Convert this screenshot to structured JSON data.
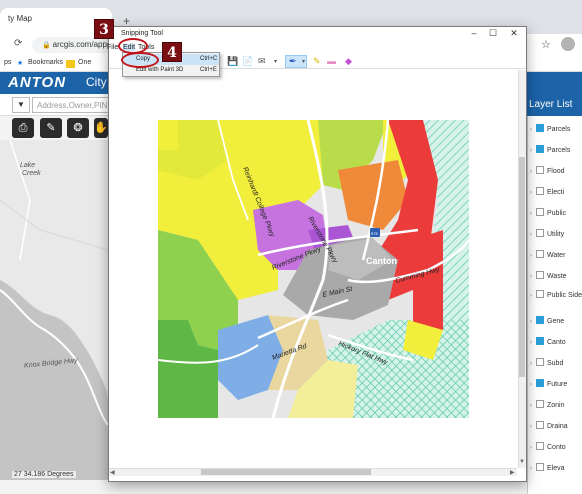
{
  "browser": {
    "tab_title": "ty Map",
    "new_tab": "+",
    "address": "arcgis.com/apps/",
    "bookmarks": [
      "ps",
      "Bookmarks",
      "One"
    ],
    "bookmarks_star": "★"
  },
  "app": {
    "logo": "ANTON",
    "logo_city": "City",
    "search_placeholder": "Address,Owner,PIN,",
    "scale": "27 34.186 Degrees",
    "bg_map_labels": [
      "Lake",
      "Creek",
      "Knox Bridge Hwy"
    ]
  },
  "layer_panel": {
    "title": "Layer List",
    "items": [
      {
        "label": "Parcels",
        "checked": true
      },
      {
        "label": "Parcels",
        "checked": true
      },
      {
        "label": "Flood",
        "checked": false
      },
      {
        "label": "Electi",
        "checked": false
      },
      {
        "label": "Public",
        "checked": false
      },
      {
        "label": "Utility",
        "checked": false
      },
      {
        "label": "Water",
        "checked": false
      },
      {
        "label": "Waste",
        "checked": false
      },
      {
        "label": "Public Sidew",
        "checked": false
      },
      {
        "label": "Gene",
        "checked": true
      },
      {
        "label": "Canto",
        "checked": true
      },
      {
        "label": "Subd",
        "checked": false
      },
      {
        "label": "Future",
        "checked": true
      },
      {
        "label": "Zonin",
        "checked": false
      },
      {
        "label": "Draina",
        "checked": false
      },
      {
        "label": "Conto",
        "checked": false
      },
      {
        "label": "Eleva",
        "checked": false
      }
    ]
  },
  "snipping_tool": {
    "title": "Snipping Tool",
    "menu": [
      "File",
      "Edit",
      "Tools"
    ],
    "edit_menu": [
      {
        "label": "Copy",
        "shortcut": "Ctrl+C"
      },
      {
        "label": "Edit with Paint 3D",
        "shortcut": "Ctrl+E"
      }
    ],
    "window_controls": {
      "minimize": "–",
      "maximize": "☐",
      "close": "✕"
    }
  },
  "annotations": {
    "step3": "3",
    "step4": "4"
  },
  "map": {
    "labels": {
      "college": "Reinhardt College Pkwy",
      "riverstone": "Riverstone Pkwy",
      "canton": "Canton",
      "cumming": "Cumming Hwy",
      "emain": "E Main St",
      "marietta": "Marietta Rd",
      "hickory": "Hickory Flat Hwy",
      "knox": "Knox Bridge Hwy",
      "shield": "575"
    }
  },
  "colors": {
    "accent_blue": "#1c63a8",
    "callout_red": "#c0141b",
    "badge_red": "#7a0e12"
  }
}
